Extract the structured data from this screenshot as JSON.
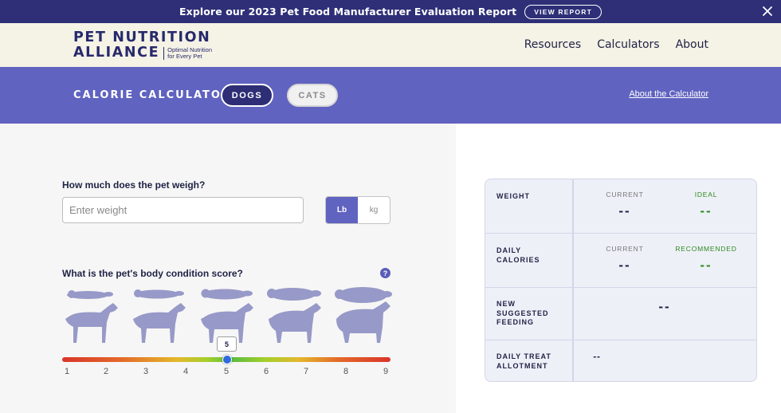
{
  "banner": {
    "text": "Explore our 2023 Pet Food Manufacturer Evaluation Report",
    "button": "VIEW REPORT"
  },
  "header": {
    "logo_line1": "PET NUTRITION",
    "logo_line2": "ALLIANCE",
    "logo_tag1": "Optimal Nutrition",
    "logo_tag2": "for Every Pet",
    "nav": [
      "Resources",
      "Calculators",
      "About"
    ]
  },
  "calc": {
    "title": "CALORIE CALCULATOR",
    "tab_dogs": "DOGS",
    "tab_cats": "CATS",
    "about_link": "About the Calculator"
  },
  "form": {
    "weight_question": "How much does the pet weigh?",
    "weight_placeholder": "Enter weight",
    "unit_lb": "Lb",
    "unit_kg": "kg",
    "bcs_question": "What is the pet's body condition score?",
    "help": "?",
    "slider_value": "5",
    "slider_min": 1,
    "slider_max": 9,
    "slider_current": 5,
    "ticks": [
      "1",
      "2",
      "3",
      "4",
      "5",
      "6",
      "7",
      "8",
      "9"
    ]
  },
  "results": {
    "weight_label": "WEIGHT",
    "weight_current_label": "CURRENT",
    "weight_ideal_label": "IDEAL",
    "weight_current": "--",
    "weight_ideal": "--",
    "calories_label_1": "DAILY",
    "calories_label_2": "CALORIES",
    "calories_current_label": "CURRENT",
    "calories_recommended_label": "RECOMMENDED",
    "calories_current": "--",
    "calories_recommended": "--",
    "feeding_label_1": "NEW",
    "feeding_label_2": "SUGGESTED",
    "feeding_label_3": "FEEDING",
    "feeding_value": "--",
    "treat_label_1": "DAILY TREAT",
    "treat_label_2": "ALLOTMENT",
    "treat_value": "--"
  },
  "colors": {
    "banner_bg": "#2e2f77",
    "calcbar_bg": "#6063c0",
    "accent_green": "#2c8a1d",
    "dog_silhouette": "#9799c8"
  }
}
